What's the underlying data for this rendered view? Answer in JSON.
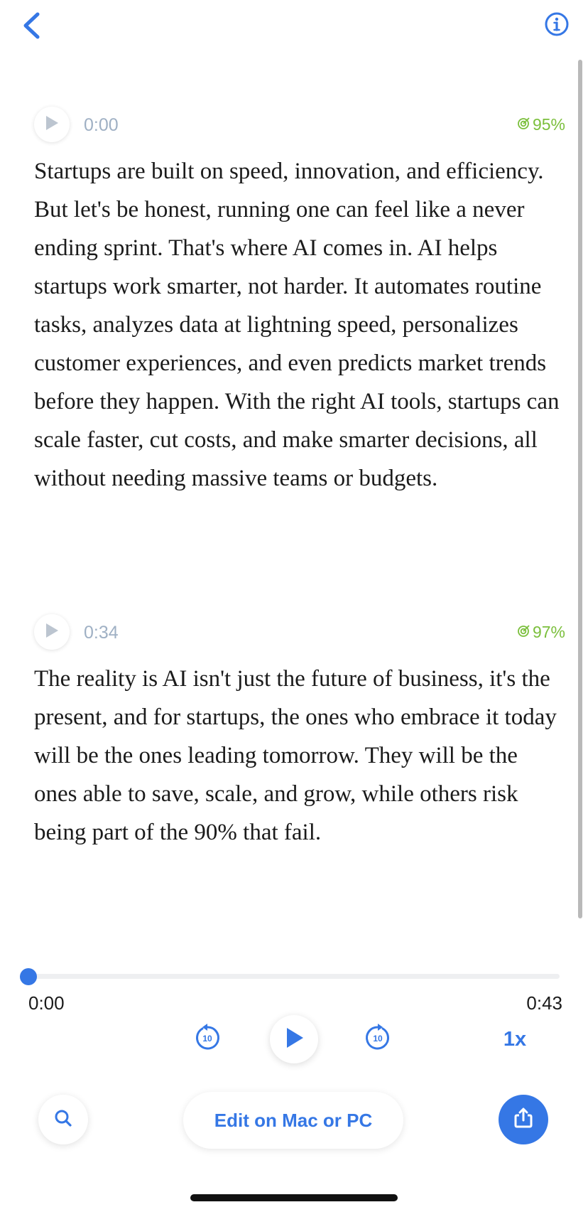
{
  "header": {
    "back_icon": "chevron-left-icon",
    "info_icon": "info-circle-icon"
  },
  "segments": [
    {
      "time": "0:00",
      "confidence": "95%",
      "text": "Startups are built on speed, innovation, and efficiency. But let's be honest, running one can feel like a never ending sprint. That's where AI comes in. AI helps startups work smarter, not harder. It automates routine tasks, analyzes data at lightning speed, personalizes customer experiences, and even predicts market trends before they happen. With the right AI tools, startups can scale faster, cut costs, and make smarter decisions, all without needing massive teams or budgets."
    },
    {
      "time": "0:34",
      "confidence": "97%",
      "text": "The reality is AI isn't just the future of business, it's the present, and for startups, the ones who embrace it today will be the ones leading tomorrow. They will be the ones able to save, scale, and grow, while others risk being part of the 90% that fail."
    }
  ],
  "player": {
    "current_time": "0:00",
    "total_time": "0:43",
    "progress_fraction": 0.0,
    "skip_back_seconds": "10",
    "skip_forward_seconds": "10",
    "speed_label": "1x"
  },
  "bottom_bar": {
    "search_icon": "search-icon",
    "edit_label": "Edit on Mac or PC",
    "share_icon": "share-icon"
  },
  "colors": {
    "accent": "#3577e5",
    "confidence": "#7bbf3c",
    "timestamp": "#9fb0c4"
  }
}
